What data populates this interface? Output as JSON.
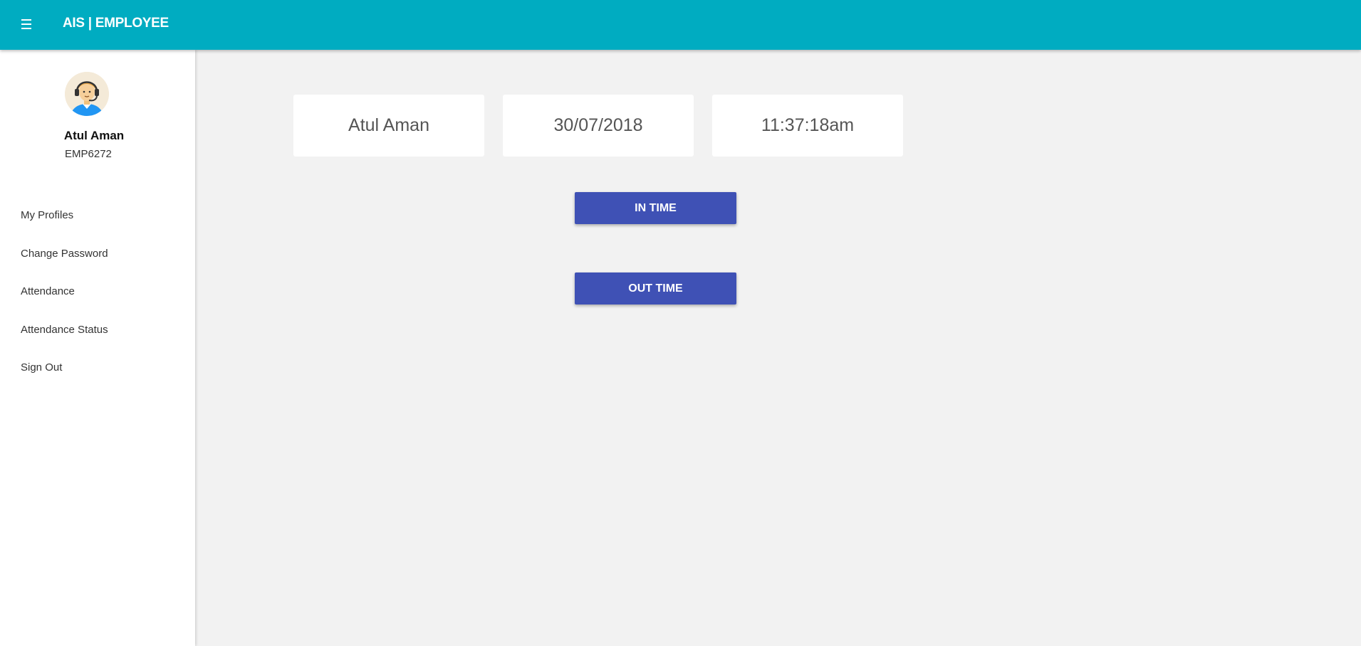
{
  "header": {
    "title": "AIS | EMPLOYEE",
    "menu_icon": "hamburger-menu-icon",
    "background_color": "#00acc1"
  },
  "sidebar": {
    "avatar_icon": "support-agent-avatar",
    "user_name": "Atul Aman",
    "employee_id": "EMP6272",
    "items": [
      {
        "label": "My Profiles"
      },
      {
        "label": "Change Password"
      },
      {
        "label": "Attendance"
      },
      {
        "label": "Attendance Status"
      },
      {
        "label": "Sign Out"
      }
    ]
  },
  "main": {
    "cards": {
      "name": "Atul Aman",
      "date": "30/07/2018",
      "time": "11:37:18am"
    },
    "buttons": {
      "in_time": "IN TIME",
      "out_time": "OUT TIME",
      "color": "#3f51b5"
    }
  }
}
